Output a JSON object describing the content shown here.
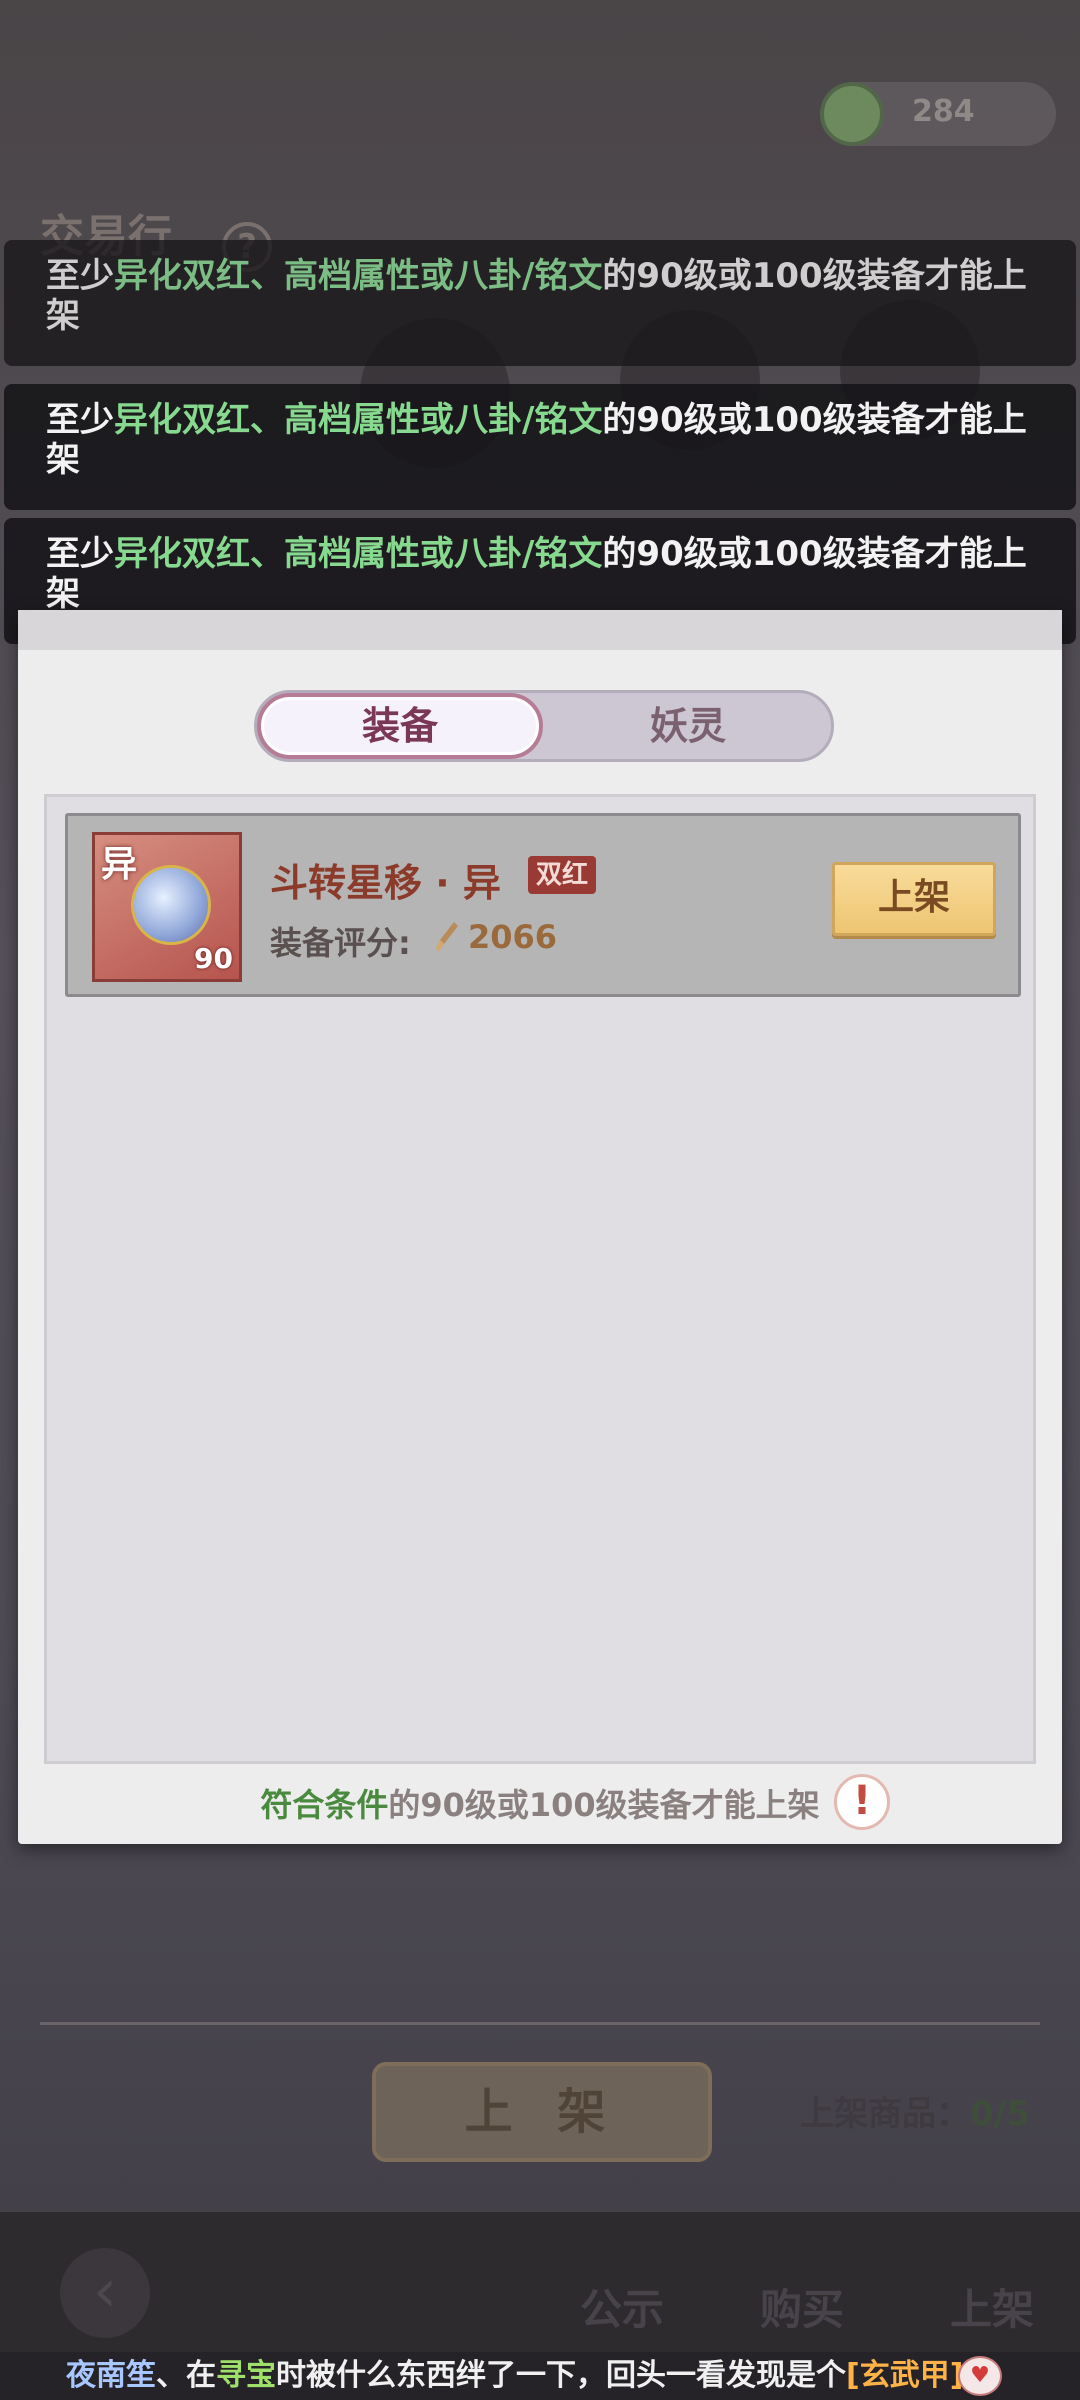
{
  "background": {
    "currency_value": "284",
    "title": "交易行",
    "shelf_button_label": "上 架",
    "shelf_count_label": "上架商品：",
    "shelf_count_value": "0/5",
    "bottom_tabs": [
      "公示",
      "购买",
      "上架"
    ]
  },
  "toasts": [
    {
      "prefix": "至少",
      "highlight": "异化双红、高档属性或八卦/铭文",
      "suffix": "的90级或100级装备才能上架"
    },
    {
      "prefix": "至少",
      "highlight": "异化双红、高档属性或八卦/铭文",
      "suffix": "的90级或100级装备才能上架"
    },
    {
      "prefix": "至少",
      "highlight": "异化双红、高档属性或八卦/铭文",
      "suffix": "的90级或100级装备才能上架"
    }
  ],
  "modal": {
    "tabs": [
      {
        "label": "装备",
        "active": true
      },
      {
        "label": "妖灵",
        "active": false
      }
    ],
    "items": [
      {
        "badge": "异",
        "level": "90",
        "name": "斗转星移 · 异",
        "tag": "双红",
        "score_label": "装备评分:",
        "score_value": "2066",
        "button_label": "上架"
      }
    ],
    "footer_highlight": "符合条件",
    "footer_text": "的90级或100级装备才能上架"
  },
  "chat": {
    "user": "夜南笙",
    "text1": "、在",
    "place": "寻宝",
    "text2": "时被什么东西绊了一下，回头一看发现是个",
    "item": "[玄武甲]"
  },
  "colors": {
    "highlight_green": "#86d98e",
    "item_name": "#8c3b2a",
    "button_gold": "#eec572",
    "tab_active_border": "#b77c95"
  }
}
